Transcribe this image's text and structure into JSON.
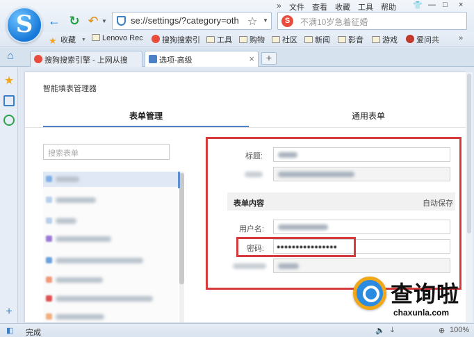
{
  "menu": {
    "items": [
      "文件",
      "查看",
      "收藏",
      "工具",
      "帮助"
    ],
    "double_arrow": "»",
    "window_controls": [
      "—",
      "□",
      "×"
    ]
  },
  "toolbar": {
    "logo_letter": "S",
    "back_icon": "back-arrow-icon",
    "refresh_icon": "refresh-icon",
    "undo_icon": "undo-icon",
    "address_url": "se://settings/?category=oth",
    "search_placeholder": "不满10岁急着征婚"
  },
  "bookmarks": {
    "items": [
      "收藏",
      "Lenovo Rec",
      "搜狗搜索引",
      "工具",
      "购物",
      "社区",
      "新闻",
      "影音",
      "游戏",
      "爱问共"
    ]
  },
  "tabs": {
    "items": [
      {
        "label": "搜狗搜索引擎 - 上网从搜",
        "active": false
      },
      {
        "label": "选项-高级",
        "active": true
      }
    ],
    "new_tab": "+"
  },
  "page": {
    "title": "智能填表管理器",
    "tab_form": "表单管理",
    "tab_common": "通用表单",
    "search_placeholder": "搜索表单"
  },
  "detail": {
    "title_label": "标题:",
    "section_title": "表单内容",
    "autosave": "自动保存",
    "username_label": "用户名:",
    "password_label": "密码:",
    "password_value": "●●●●●●●●●●●●●●●●"
  },
  "status": {
    "text": "完成",
    "zoom": "100%"
  },
  "watermark": {
    "cn": "查询啦",
    "en": "chaxunla.com"
  },
  "colors": {
    "accent": "#4b82c7",
    "highlight_red": "#d63b3b"
  }
}
